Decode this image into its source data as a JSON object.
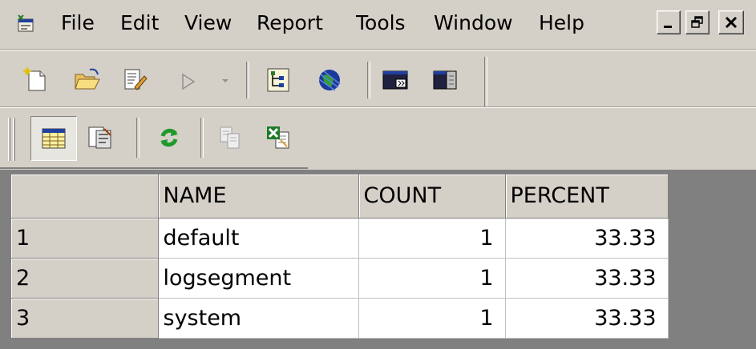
{
  "menubar": {
    "items": [
      "File",
      "Edit",
      "View",
      "Report",
      "Tools",
      "Window",
      "Help"
    ],
    "window_buttons": {
      "minimize": "_",
      "restore": "🗗",
      "close": "X"
    }
  },
  "toolbar1": {
    "icons": [
      "new-document-icon",
      "open-folder-icon",
      "edit-document-icon",
      "run-icon",
      "dropdown-arrow-icon",
      "tree-view-icon",
      "globe-icon",
      "console-window-icon",
      "split-window-icon"
    ]
  },
  "toolbar2": {
    "icons": [
      "grid-view-icon",
      "form-view-icon",
      "refresh-icon",
      "copy-icon",
      "export-excel-icon"
    ]
  },
  "grid": {
    "columns": [
      "",
      "NAME",
      "COUNT",
      "PERCENT"
    ],
    "rows": [
      {
        "num": "1",
        "name": "default",
        "count": "1",
        "percent": "33.33"
      },
      {
        "num": "2",
        "name": "logsegment",
        "count": "1",
        "percent": "33.33"
      },
      {
        "num": "3",
        "name": "system",
        "count": "1",
        "percent": "33.33"
      }
    ]
  },
  "colors": {
    "chrome": "#d4d0c8",
    "grid_background": "#808080",
    "cell_background": "#ffffff",
    "refresh_green": "#1f9a2a",
    "icon_blue": "#1a3a9a"
  }
}
